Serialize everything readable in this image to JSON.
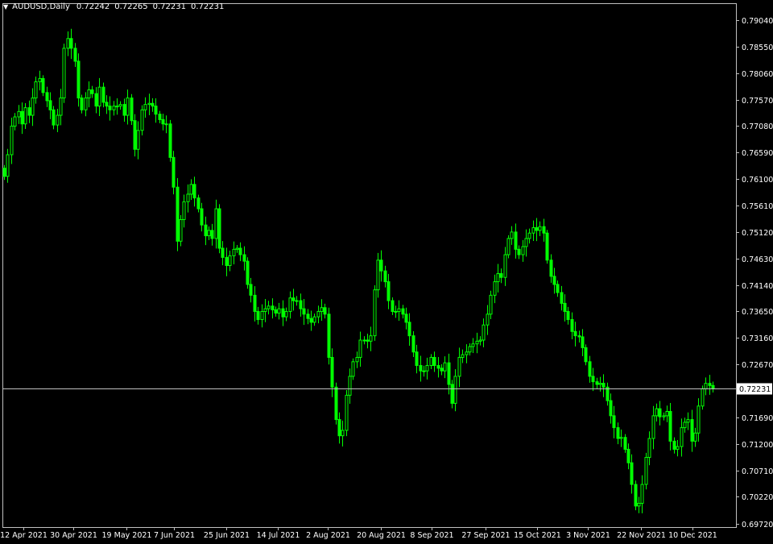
{
  "header": {
    "symbol": "AUDUSD,Daily",
    "open": "0.72242",
    "high": "0.72265",
    "low": "0.72231",
    "close": "0.72231"
  },
  "current_price_label": "0.72231",
  "colors": {
    "background": "#000000",
    "candle": "#00ff00",
    "axis": "#c0c0c0",
    "text": "#ffffff",
    "price_line": "#c0c0c0"
  },
  "chart_data": {
    "type": "candlestick",
    "title": "AUDUSD,Daily",
    "grid": false,
    "ylim": [
      0.6972,
      0.7953
    ],
    "y_ticks": [
      "0.79040",
      "0.78550",
      "0.78060",
      "0.77570",
      "0.77080",
      "0.76590",
      "0.76100",
      "0.75610",
      "0.75120",
      "0.74630",
      "0.74140",
      "0.73650",
      "0.73160",
      "0.72670",
      "0.72231",
      "0.71690",
      "0.71200",
      "0.70710",
      "0.70220",
      "0.69720"
    ],
    "x_ticks": [
      "12 Apr 2021",
      "30 Apr 2021",
      "19 May 2021",
      "7 Jun 2021",
      "25 Jun 2021",
      "14 Jul 2021",
      "2 Aug 2021",
      "20 Aug 2021",
      "8 Sep 2021",
      "27 Sep 2021",
      "15 Oct 2021",
      "3 Nov 2021",
      "22 Nov 2021",
      "10 Dec 2021"
    ],
    "last_price": 0.72231,
    "closes": [
      0.7615,
      0.7655,
      0.7708,
      0.7725,
      0.7735,
      0.7712,
      0.7742,
      0.7728,
      0.776,
      0.779,
      0.7796,
      0.777,
      0.7755,
      0.7738,
      0.771,
      0.7728,
      0.776,
      0.7852,
      0.787,
      0.7852,
      0.7828,
      0.776,
      0.7738,
      0.776,
      0.7775,
      0.7768,
      0.7745,
      0.778,
      0.7752,
      0.7745,
      0.7738,
      0.7745,
      0.7745,
      0.7748,
      0.7728,
      0.776,
      0.7718,
      0.7665,
      0.77,
      0.7738,
      0.7748,
      0.775,
      0.7745,
      0.773,
      0.772,
      0.7712,
      0.7712,
      0.765,
      0.7595,
      0.7495,
      0.7535,
      0.7568,
      0.7582,
      0.76,
      0.7575,
      0.7555,
      0.7525,
      0.7505,
      0.7515,
      0.75,
      0.7555,
      0.7482,
      0.7465,
      0.745,
      0.7468,
      0.748,
      0.7482,
      0.747,
      0.7458,
      0.7415,
      0.7395,
      0.7365,
      0.735,
      0.7365,
      0.737,
      0.7375,
      0.7368,
      0.7362,
      0.737,
      0.7355,
      0.7365,
      0.739,
      0.7385,
      0.7385,
      0.737,
      0.736,
      0.7352,
      0.7345,
      0.7355,
      0.7365,
      0.7372,
      0.736,
      0.728,
      0.7225,
      0.7165,
      0.7135,
      0.7145,
      0.721,
      0.7245,
      0.7272,
      0.728,
      0.7312,
      0.7312,
      0.731,
      0.732,
      0.7405,
      0.746,
      0.744,
      0.742,
      0.7385,
      0.7365,
      0.7365,
      0.737,
      0.736,
      0.7345,
      0.732,
      0.729,
      0.7265,
      0.7255,
      0.7255,
      0.7265,
      0.728,
      0.7265,
      0.726,
      0.7255,
      0.727,
      0.723,
      0.7195,
      0.7245,
      0.728,
      0.7285,
      0.729,
      0.73,
      0.7305,
      0.731,
      0.7312,
      0.734,
      0.736,
      0.7395,
      0.742,
      0.7435,
      0.7428,
      0.747,
      0.75,
      0.7512,
      0.748,
      0.747,
      0.7485,
      0.75,
      0.751,
      0.752,
      0.7515,
      0.7522,
      0.751,
      0.746,
      0.743,
      0.7415,
      0.74,
      0.738,
      0.7365,
      0.735,
      0.7328,
      0.732,
      0.7318,
      0.7298,
      0.7272,
      0.7245,
      0.7235,
      0.723,
      0.7232,
      0.7225,
      0.72,
      0.7172,
      0.715,
      0.713,
      0.7132,
      0.711,
      0.7085,
      0.7045,
      0.7005,
      0.701,
      0.7045,
      0.7095,
      0.713,
      0.7172,
      0.7185,
      0.717,
      0.7172,
      0.718,
      0.7125,
      0.711,
      0.7115,
      0.715,
      0.716,
      0.7165,
      0.7125,
      0.714,
      0.719,
      0.7222,
      0.7232,
      0.7228,
      0.7223
    ]
  }
}
